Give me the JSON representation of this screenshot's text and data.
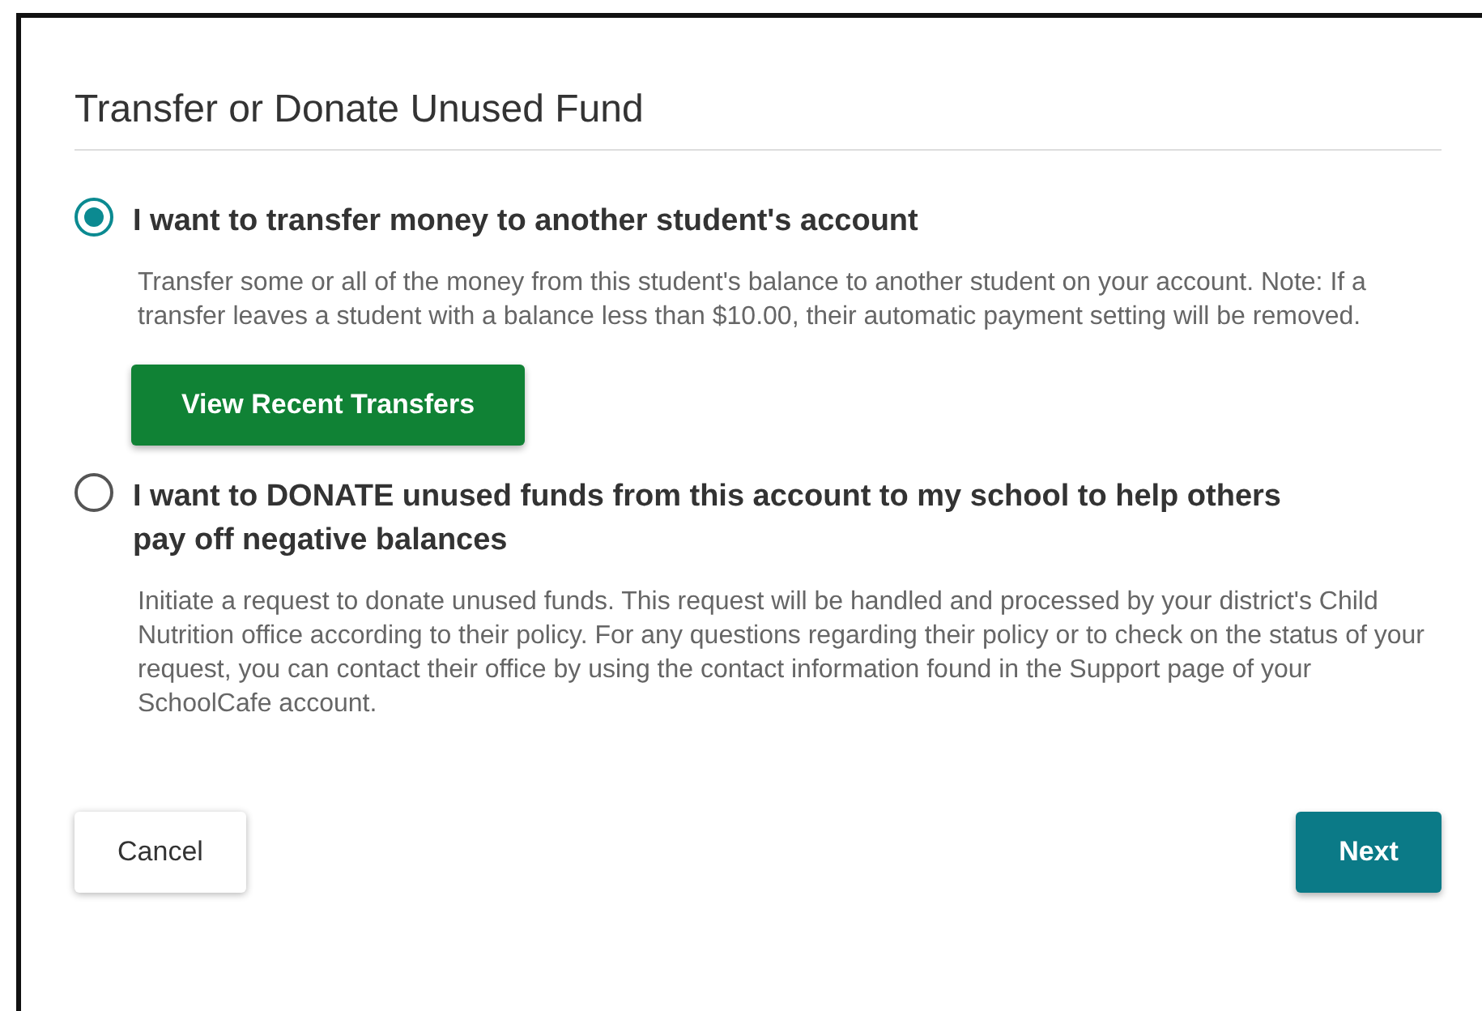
{
  "dialog": {
    "title": "Transfer or Donate Unused Fund",
    "options": [
      {
        "label": "I want to transfer money to another student's account",
        "selected": true,
        "description": "Transfer some or all of the money from this student's balance to another student on your account. Note: If a transfer leaves a student with a balance less than $10.00, their automatic payment setting will be removed.",
        "button": "View Recent Transfers"
      },
      {
        "label": "I want to DONATE unused funds from this account to my school to help others pay off negative balances",
        "selected": false,
        "description": "Initiate a request to donate unused funds. This request will be handled and processed by your district's Child Nutrition office according to their policy. For any questions regarding their policy or to check on the status of your request, you can contact their office by using the contact information found in the Support page of your SchoolCafe account."
      }
    ],
    "cancel": "Cancel",
    "next": "Next"
  }
}
